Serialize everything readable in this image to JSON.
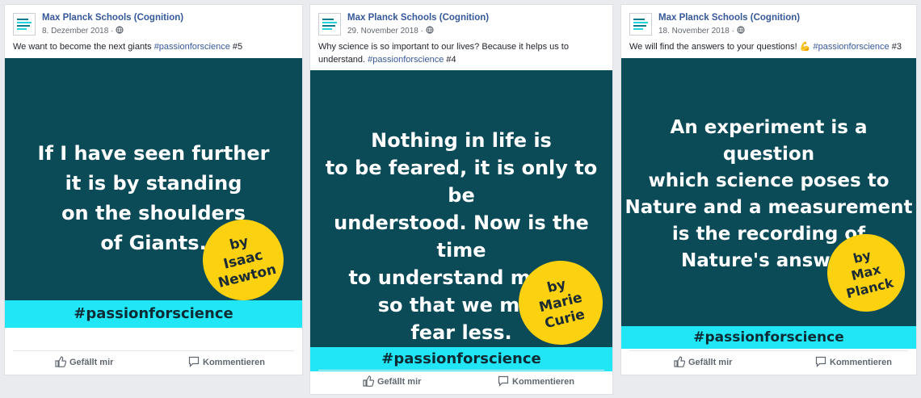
{
  "posts": [
    {
      "page_name": "Max Planck Schools (Cognition)",
      "date": "8. Dezember 2018",
      "text": "We want to become the next giants ",
      "hashtag": "#passionforscience",
      "suffix": " #5",
      "quote": "If I have seen further\nit is by standing\non the shoulders\nof Giants.",
      "author": "by\nIsaac\nNewton",
      "band": "#passionforscience",
      "like_label": "Gefällt mir",
      "comment_label": "Kommentieren"
    },
    {
      "page_name": "Max Planck Schools (Cognition)",
      "date": "29. November 2018",
      "text": "Why science is so important to our lives? Because it helps us to understand. ",
      "hashtag": "#passionforscience",
      "suffix": " #4",
      "quote": "Nothing in life is\nto be feared, it is only to be\nunderstood. Now is the time\nto understand more,\nso that we may\nfear less.",
      "author": "by\nMarie\nCurie",
      "band": "#passionforscience",
      "like_label": "Gefällt mir",
      "comment_label": "Kommentieren"
    },
    {
      "page_name": "Max Planck Schools (Cognition)",
      "date": "18. November 2018",
      "text": "We will find the answers to your questions! 💪 ",
      "hashtag": "#passionforscience",
      "suffix": " #3",
      "quote": "An experiment is a question\nwhich science poses to\nNature and a measurement\nis the recording of\nNature's answer.",
      "author": "by\nMax\nPlanck",
      "band": "#passionforscience",
      "like_label": "Gefällt mir",
      "comment_label": "Kommentieren"
    }
  ],
  "colors": {
    "image_bg": "#0b4a57",
    "band": "#20e6f5",
    "badge": "#fcd10f",
    "link": "#365899"
  },
  "icons": {
    "globe": "globe-icon",
    "like": "thumbs-up-icon",
    "comment": "comment-icon"
  }
}
